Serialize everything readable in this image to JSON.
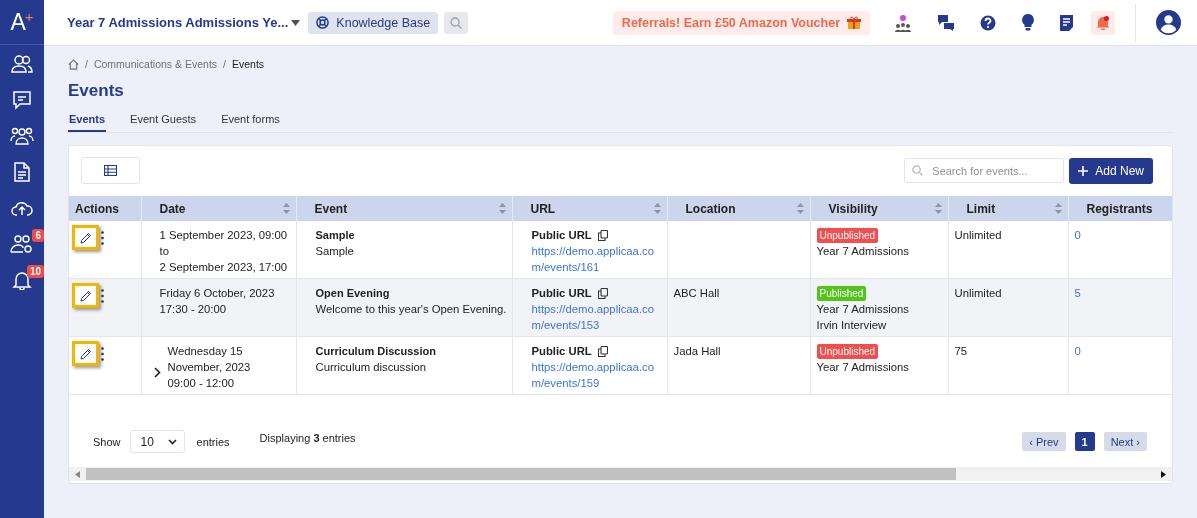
{
  "sidebar": {
    "logo": {
      "letter": "A",
      "mark": "+"
    },
    "badges": [
      "6",
      "10"
    ]
  },
  "topbar": {
    "school": "Year 7 Admissions Admissions Ye...",
    "knowledge_base": "Knowledge Base",
    "referral": "Referrals! Earn £50 Amazon Voucher",
    "notification_dot": true
  },
  "breadcrumb": {
    "separator": "/",
    "items": [
      "Communications & Events",
      "Events"
    ]
  },
  "page_title": "Events",
  "tabs": [
    {
      "label": "Events",
      "selected": true
    },
    {
      "label": "Event Guests",
      "selected": false
    },
    {
      "label": "Event forms",
      "selected": false
    }
  ],
  "search": {
    "placeholder": "Search for events..."
  },
  "add_button": "Add New",
  "table": {
    "columns": [
      {
        "label": "Actions",
        "sortable": false
      },
      {
        "label": "Date",
        "sortable": true
      },
      {
        "label": "Event",
        "sortable": true
      },
      {
        "label": "URL",
        "sortable": true
      },
      {
        "label": "Location",
        "sortable": true
      },
      {
        "label": "Visibility",
        "sortable": true
      },
      {
        "label": "Limit",
        "sortable": true
      },
      {
        "label": "Registrants",
        "sortable": false
      }
    ],
    "rows": [
      {
        "expandable": false,
        "date": [
          "1 September 2023, 09:00",
          "to",
          "2 September 2023, 17:00"
        ],
        "event": "Sample",
        "description": "Sample",
        "url_label": "Public URL",
        "url": "https://demo.applicaa.com/events/161",
        "badge": {
          "label": "Unpublished",
          "color": "#f24e4e"
        },
        "visibility": [
          "Year 7 Admissions"
        ],
        "limit": "Unlimited",
        "registrants": "0"
      },
      {
        "expandable": false,
        "date": [
          "Friday 6 October, 2023",
          "17:30 - 20:00"
        ],
        "event": "Open Evening",
        "description": "Welcome to this year's Open Evening.",
        "url_label": "Public URL",
        "url": "https://demo.applicaa.com/events/153",
        "location": "ABC Hall",
        "badge": {
          "label": "Published",
          "color": "#52c41a"
        },
        "visibility": [
          "Year 7 Admissions",
          "Irvin Interview"
        ],
        "limit": "Unlimited",
        "registrants": "5"
      },
      {
        "expandable": true,
        "date": [
          "Wednesday 15",
          "November, 2023",
          "09:00 - 12:00"
        ],
        "event": "Curriculum Discussion",
        "description": "Curriculum discussion",
        "url_label": "Public URL",
        "url": "https://demo.applicaa.com/events/159",
        "location": "Jada Hall",
        "badge": {
          "label": "Unpublished",
          "color": "#f24e4e"
        },
        "visibility": [
          "Year 7 Admissions"
        ],
        "limit": "75",
        "registrants": "0"
      }
    ]
  },
  "footer": {
    "show": "Show",
    "page_size": "10",
    "entries": "entries",
    "displaying": "Displaying **3** entries"
  },
  "pagination": [
    {
      "label": "‹ Prev",
      "selected": false
    },
    {
      "label": "1",
      "selected": true
    },
    {
      "label": "Next ›",
      "selected": false
    }
  ]
}
